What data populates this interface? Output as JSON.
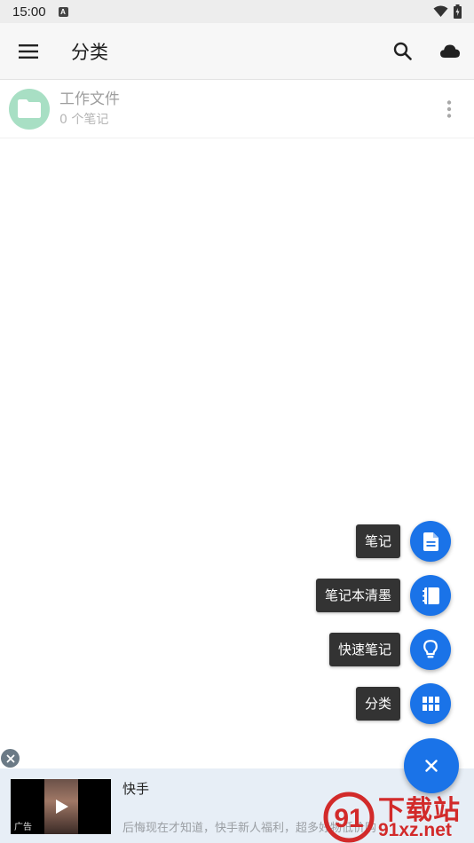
{
  "status_bar": {
    "time": "15:00"
  },
  "app_bar": {
    "title": "分类"
  },
  "list": {
    "items": [
      {
        "title": "工作文件",
        "subtitle": "0 个笔记"
      }
    ]
  },
  "fab_menu": {
    "items": [
      {
        "label": "笔记",
        "icon": "document-icon"
      },
      {
        "label": "笔记本清墨",
        "icon": "notebook-icon"
      },
      {
        "label": "快速笔记",
        "icon": "lightbulb-icon"
      },
      {
        "label": "分类",
        "icon": "grid-icon"
      }
    ],
    "main_icon": "close-icon"
  },
  "ad": {
    "title": "快手",
    "description": "后悔现在才知道，快手新人福利，超多好物低价购",
    "tag": "广告"
  },
  "watermark": {
    "text": "下载站",
    "url": "91xz.net"
  },
  "colors": {
    "accent": "#1a73e8",
    "folder": "#a8dfc4",
    "watermark": "#d22a2a"
  }
}
